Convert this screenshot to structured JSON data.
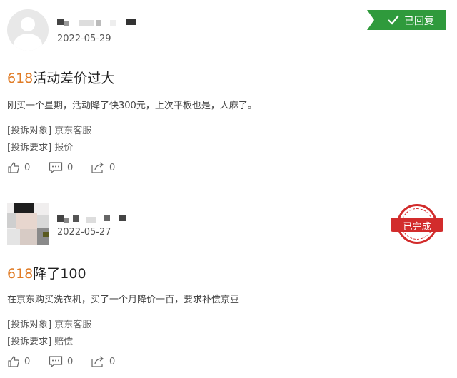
{
  "posts": [
    {
      "date": "2022-05-29",
      "status": "已回复",
      "title_num": "618",
      "title_text": "活动差价过大",
      "content": "刚买一个星期，活动降了快300元，上次平板也是，人麻了。",
      "target_label": "[投诉对象]",
      "target_value": "京东客服",
      "request_label": "[投诉要求]",
      "request_value": "报价",
      "likes": "0",
      "comments": "0",
      "shares": "0"
    },
    {
      "date": "2022-05-27",
      "status": "已完成",
      "title_num": "618",
      "title_text": "降了100",
      "content": "在京东购买洗衣机，买了一个月降价一百，要求补偿京豆",
      "target_label": "[投诉对象]",
      "target_value": "京东客服",
      "request_label": "[投诉要求]",
      "request_value": "赔偿",
      "likes": "0",
      "comments": "0",
      "shares": "0"
    }
  ],
  "colors": {
    "replied_badge": "#2f9a3c",
    "completed_stamp": "#d22c2c",
    "title_number": "#e07b25"
  }
}
